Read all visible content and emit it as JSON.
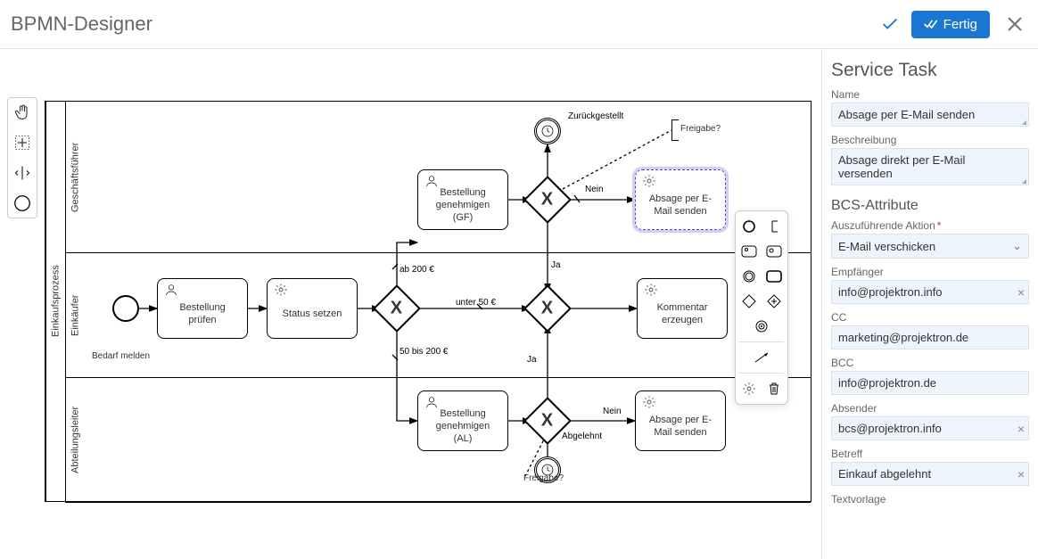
{
  "header": {
    "title": "BPMN-Designer",
    "done_label": "Fertig"
  },
  "props": {
    "heading": "Service Task",
    "name_label": "Name",
    "name_value": "Absage per E-Mail senden",
    "desc_label": "Beschreibung",
    "desc_value": "Absage direkt per E-Mail versenden",
    "section2": "BCS-Attribute",
    "action_label": "Auszuführende Aktion",
    "action_value": "E-Mail verschicken",
    "recipient_label": "Empfänger",
    "recipient_value": "info@projektron.info",
    "cc_label": "CC",
    "cc_value": "marketing@projektron.de",
    "bcc_label": "BCC",
    "bcc_value": "info@projektron.de",
    "sender_label": "Absender",
    "sender_value": "bcs@projektron.info",
    "subject_label": "Betreff",
    "subject_value": "Einkauf abgelehnt",
    "template_label": "Textvorlage"
  },
  "pool": {
    "name": "Einkaufsprozess",
    "lanes": [
      "Geschäftsführer",
      "Einkäufer",
      "Abteilungsleiter"
    ]
  },
  "tasks": {
    "pruefen": "Bestellung prüfen",
    "status": "Status setzen",
    "gen_gf": "Bestellung genehmigen (GF)",
    "gen_al": "Bestellung genehmigen (AL)",
    "kommentar": "Kommentar erzeugen",
    "absage_gf": "Absage per E-Mail senden",
    "absage_al": "Absage per E-Mail senden"
  },
  "labels": {
    "bedarf": "Bedarf melden",
    "ab200": "ab 200 €",
    "unter50": "unter 50 €",
    "bis200": "50 bis 200 €",
    "nein1": "Nein",
    "nein2": "Nein",
    "ja1": "Ja",
    "ja2": "Ja",
    "zurueck": "Zurückgestellt",
    "freigabe1": "Freigabe?",
    "freigabe2": "Freigabe?",
    "abgelehnt": "Abgelehnt"
  }
}
